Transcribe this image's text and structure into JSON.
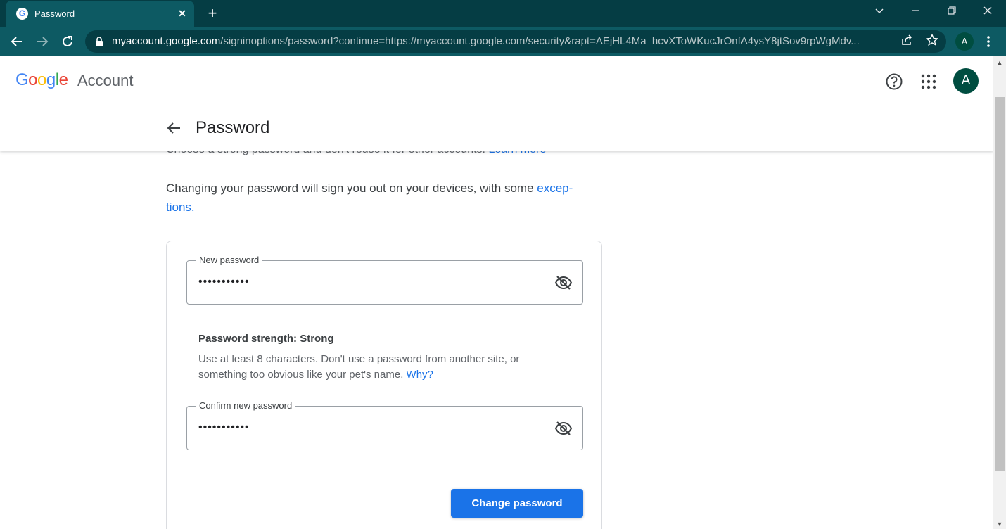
{
  "browser": {
    "tab_title": "Password",
    "tab_favicon_letter": "G",
    "tab_close": "✕",
    "new_tab": "+",
    "url_host": "myaccount.google.com",
    "url_rest": "/signinoptions/password?continue=https://myaccount.google.com/security&rapt=AEjHL4Ma_hcvXToWKucJrOnfA4ysY8jtSov9rpWgMdv...",
    "profile_letter": "A",
    "icons": [
      "back-icon",
      "forward-icon",
      "reload-icon",
      "lock-icon",
      "share-icon",
      "star-icon",
      "more-icon"
    ]
  },
  "header": {
    "logo": {
      "g1": "G",
      "o1": "o",
      "o2": "o",
      "g2": "g",
      "l": "l",
      "e": "e"
    },
    "account_word": "Account",
    "avatar_letter": "A",
    "icons": [
      "help-icon",
      "apps-grid-icon"
    ]
  },
  "page": {
    "title": "Password",
    "cut_text": "Choose a strong password and don't reuse it for other accounts.",
    "cut_link": "Learn more",
    "info_text": "Changing your password will sign you out on your devices, with some ",
    "info_link_1": "excep-",
    "info_link_2": "tions",
    "info_period": "."
  },
  "form": {
    "new_password_label": "New password",
    "new_password_value": "•••••••••••",
    "strength_title": "Password strength: Strong",
    "strength_help": "Use at least 8 characters. Don't use a password from another site, or something too obvious like your pet's name. ",
    "strength_link": "Why?",
    "confirm_password_label": "Confirm new password",
    "confirm_password_value": "•••••••••••",
    "submit_label": "Change password",
    "icons": [
      "eye-off-icon"
    ]
  },
  "colors": {
    "chrome_dark": "#053d44",
    "chrome_toolbar": "#0d5a63",
    "primary_blue": "#1a73e8",
    "avatar_green": "#004d40"
  }
}
